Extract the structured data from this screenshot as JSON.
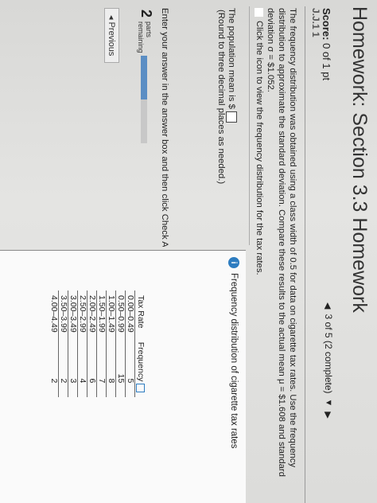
{
  "header": {
    "title": "Homework: Section 3.3 Homework"
  },
  "score": {
    "label": "Score:",
    "value": "0 of 1 pt"
  },
  "question": {
    "cropped_label": "J.J.1 1",
    "nav_text": "3 of 5 (2 complete)",
    "prompt": "The frequency distribution was obtained using a class width of 0.5 for data on cigarette tax rates. Use the frequency distribution to approximate the standard deviation. Compare these results to the actual mean μ = $1.608 and standard deviation σ = $1.052.",
    "table_link": "Click the icon to view the frequency distribution for the tax rates.",
    "mean_label": "The population mean is $",
    "rounding": "(Round to three decimal places as needed.)",
    "instruction": "Enter your answer in the answer box and then click Check Answer."
  },
  "parts": {
    "count": "2",
    "line1": "parts",
    "line2": "remaining",
    "progress": 0.5
  },
  "previous_button": "◂ Previous",
  "popup": {
    "title": "Frequency distribution of cigarette tax rates",
    "columns": [
      "Tax Rate",
      "Frequency"
    ],
    "rows": [
      [
        "0.00–0.49",
        "5"
      ],
      [
        "0.50–0.99",
        "15"
      ],
      [
        "1.00–1.49",
        "8"
      ],
      [
        "1.50–1.99",
        "7"
      ],
      [
        "2.00–2.49",
        "6"
      ],
      [
        "2.50–2.99",
        "4"
      ],
      [
        "3.00–3.49",
        "3"
      ],
      [
        "3.50–3.99",
        "2"
      ],
      [
        "4.00–4.49",
        "2"
      ]
    ]
  },
  "icons": {
    "table_icon": "grid-icon",
    "info_icon": "info-icon",
    "copy_icon": "copy-icon"
  },
  "colors": {
    "accent": "#2d7cc0",
    "progress": "#5b8ec4"
  }
}
